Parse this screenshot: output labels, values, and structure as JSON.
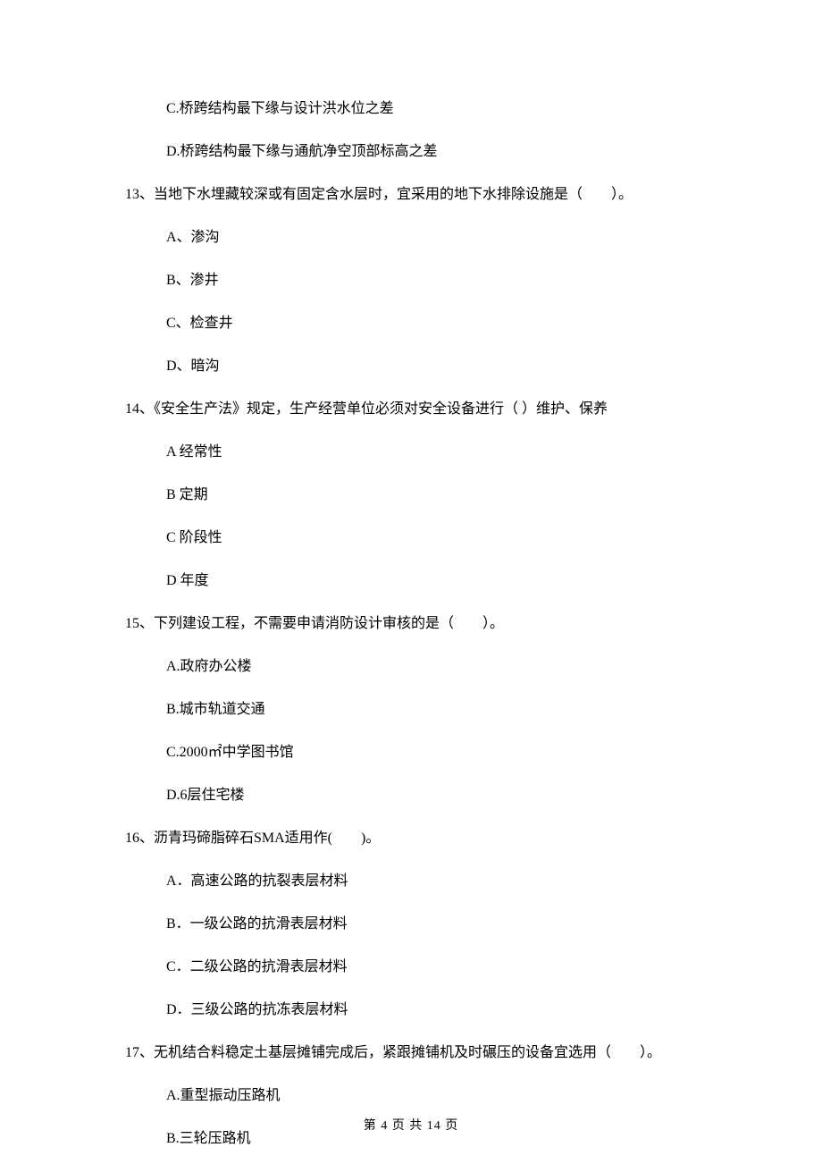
{
  "options_pre": [
    "C.桥跨结构最下缘与设计洪水位之差",
    "D.桥跨结构最下缘与通航净空顶部标高之差"
  ],
  "questions": [
    {
      "stem": "13、当地下水埋藏较深或有固定含水层时，宜采用的地下水排除设施是（　　）。",
      "options": [
        "A、渗沟",
        "B、渗井",
        "C、检查井",
        "D、暗沟"
      ]
    },
    {
      "stem": "14、《安全生产法》规定，生产经营单位必须对安全设备进行（   ）维护、保养",
      "options": [
        "A 经常性",
        "B 定期",
        "C 阶段性",
        "D 年度"
      ]
    },
    {
      "stem": "15、下列建设工程，不需要申请消防设计审核的是（　　）。",
      "options": [
        "A.政府办公楼",
        "B.城市轨道交通",
        "C.2000㎡中学图书馆",
        "D.6层住宅楼"
      ]
    },
    {
      "stem": "16、沥青玛碲脂碎石SMA适用作(　　)。",
      "options": [
        "A．高速公路的抗裂表层材料",
        "B．一级公路的抗滑表层材料",
        "C．二级公路的抗滑表层材料",
        "D．三级公路的抗冻表层材料"
      ]
    },
    {
      "stem": "17、无机结合料稳定土基层摊铺完成后，紧跟摊铺机及时碾压的设备宜选用（　　）。",
      "options": [
        "A.重型振动压路机",
        "B.三轮压路机"
      ]
    }
  ],
  "footer": "第 4 页 共 14 页"
}
